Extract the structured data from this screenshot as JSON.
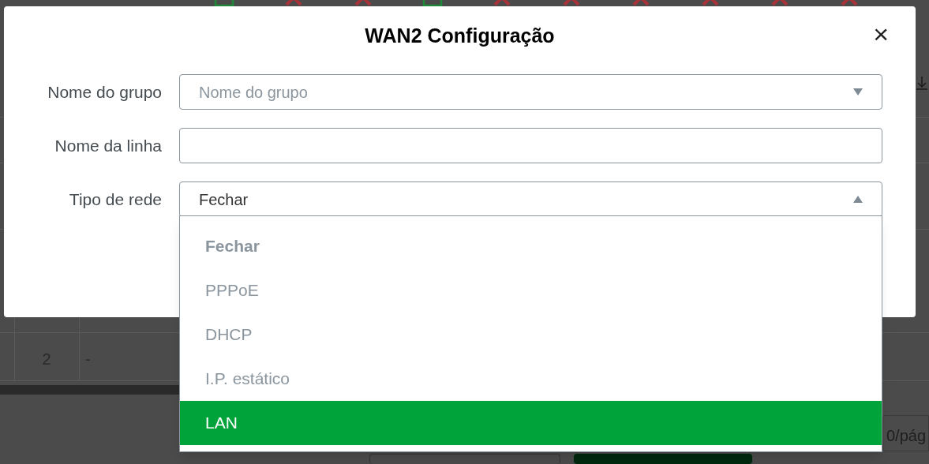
{
  "background": {
    "status_icons": [
      {
        "kind": "ok"
      },
      {
        "kind": "error"
      },
      {
        "kind": "error"
      },
      {
        "kind": "ok"
      },
      {
        "kind": "error"
      },
      {
        "kind": "error"
      },
      {
        "kind": "error"
      },
      {
        "kind": "error"
      },
      {
        "kind": "error"
      },
      {
        "kind": "error"
      }
    ],
    "table_rows": [
      {
        "column_1": "2",
        "column_2": "-"
      }
    ],
    "pagination": "0/pág"
  },
  "dialog": {
    "title": "WAN2 Configuração",
    "close": "×",
    "fields": [
      {
        "kind": "select",
        "label": "Nome do grupo",
        "placeholder": "Nome do grupo",
        "expanded": false
      },
      {
        "kind": "text",
        "label": "Nome da linha"
      },
      {
        "kind": "select",
        "label": "Tipo de rede",
        "value": "Fechar",
        "expanded": true
      }
    ],
    "dropdown_options": [
      {
        "label": "Fechar",
        "selected": true,
        "highlighted": false
      },
      {
        "label": "PPPoE",
        "selected": false,
        "highlighted": false
      },
      {
        "label": "DHCP",
        "selected": false,
        "highlighted": false
      },
      {
        "label": "I.P. estático",
        "selected": false,
        "highlighted": false
      },
      {
        "label": "LAN",
        "selected": false,
        "highlighted": true
      }
    ]
  }
}
